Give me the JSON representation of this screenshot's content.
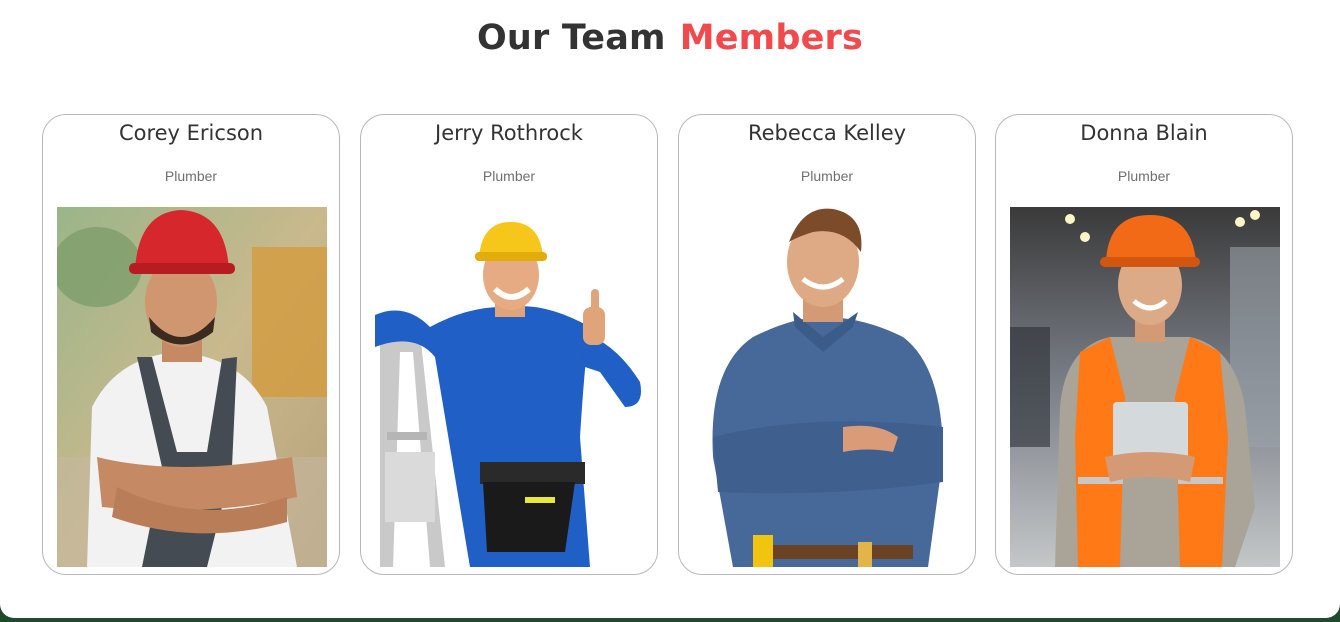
{
  "section": {
    "title_part1": "Our Team",
    "title_part2": "Members"
  },
  "colors": {
    "accent": "#f04a4c",
    "heading": "#333333",
    "footer_band": "#1f4a2c"
  },
  "members": [
    {
      "name": "Corey Ericson",
      "role": "Plumber",
      "photo": "worker-red-helmet-photo"
    },
    {
      "name": "Jerry Rothrock",
      "role": "Plumber",
      "photo": "worker-yellow-helmet-ladder-photo"
    },
    {
      "name": "Rebecca Kelley",
      "role": "Plumber",
      "photo": "worker-denim-shirt-photo"
    },
    {
      "name": "Donna Blain",
      "role": "Plumber",
      "photo": "worker-orange-vest-tablet-photo"
    }
  ]
}
